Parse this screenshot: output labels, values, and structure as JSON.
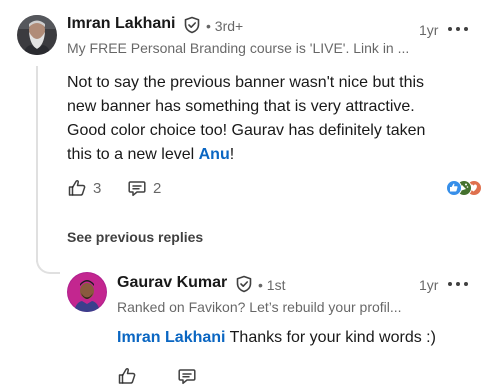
{
  "comment": {
    "author": "Imran Lakhani",
    "degree": "• 3rd+",
    "headline": "My FREE Personal Branding course is 'LIVE'. Link in ...",
    "time": "1yr",
    "text_line1": "Not to say the previous banner wasn't nice but this",
    "text_line2": "new banner has something that is very attractive.",
    "text_line3": "Good color choice too! Gaurav has definitely taken",
    "text_line4_prefix": "this to a new level ",
    "mention": "Anu",
    "text_line4_suffix": "!",
    "like_count": "3",
    "reply_count": "2",
    "reaction_icons": [
      "like-icon",
      "celebrate-icon",
      "love-icon"
    ]
  },
  "see_previous_replies": "See previous replies",
  "reply": {
    "author": "Gaurav Kumar",
    "degree": "• 1st",
    "headline": "Ranked on Favikon? Let’s rebuild your profil...",
    "time": "1yr",
    "mention": "Imran Lakhani",
    "text": " Thanks for your kind words :)"
  },
  "colors": {
    "mention": "#0a66c2",
    "like_reaction": "#378fe9",
    "celebrate_reaction": "#44712e",
    "love_reaction": "#df704d"
  }
}
